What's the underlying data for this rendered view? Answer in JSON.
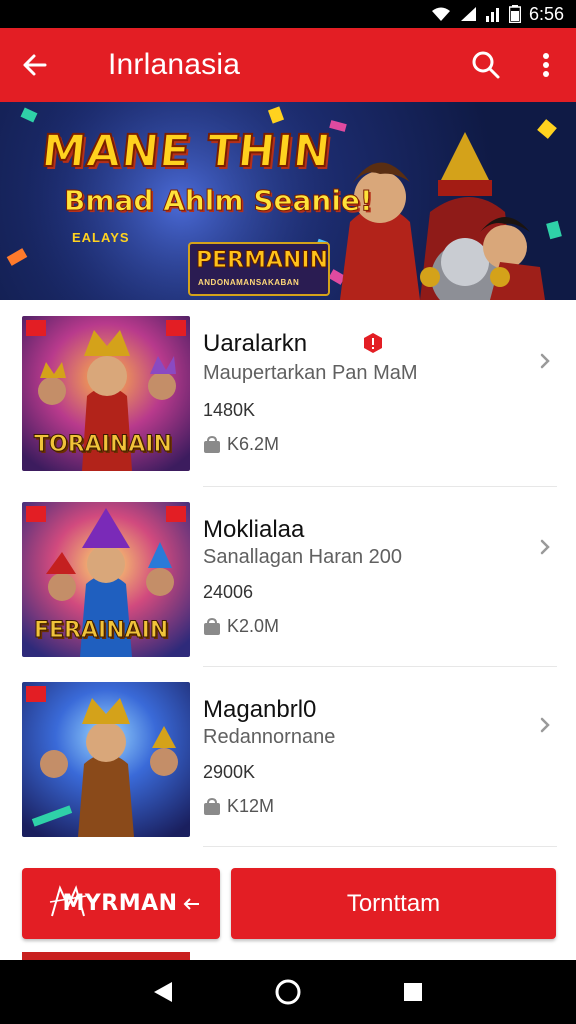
{
  "status_bar": {
    "time": "6:56",
    "icons": [
      "wifi-icon",
      "signal-icon",
      "battery-icon"
    ]
  },
  "app_bar": {
    "title": "Inrlanasia",
    "back_icon": "arrow-left-icon",
    "search_icon": "search-icon",
    "menu_icon": "more-vert-icon",
    "color": "#e31e24"
  },
  "banner": {
    "title": "MANE THIN",
    "subtitle": "Bmad Ahlm Seanie!",
    "small_text": "EALAYS",
    "logo_text": "PERMANIN",
    "logo_sub": "ANDONAMANSAKABAN"
  },
  "items": [
    {
      "name": "Uaralarkn",
      "subtitle": "Maupertarkan Pan MaM",
      "count": "1480K",
      "size": "K6.2M",
      "thumb_text": "TORAINAIN",
      "has_badge": true
    },
    {
      "name": "Moklialaa",
      "subtitle": "Sanallagan Haran 200",
      "count": "24006",
      "size": "K2.0M",
      "thumb_text": "FERAINAIN",
      "has_badge": false
    },
    {
      "name": "Maganbrl0",
      "subtitle": "Redannornane",
      "count": "2900K",
      "size": "K12M",
      "thumb_text": "",
      "has_badge": false
    }
  ],
  "buttons": {
    "left_label": "MYRMAN",
    "right_label": "Tornttam"
  },
  "nav_bar": {
    "icons": [
      "back-triangle-icon",
      "home-circle-icon",
      "recents-square-icon"
    ]
  },
  "colors": {
    "primary": "#e31e24",
    "banner_bg": "#1b2a6b",
    "title_yellow": "#ffd21f"
  }
}
